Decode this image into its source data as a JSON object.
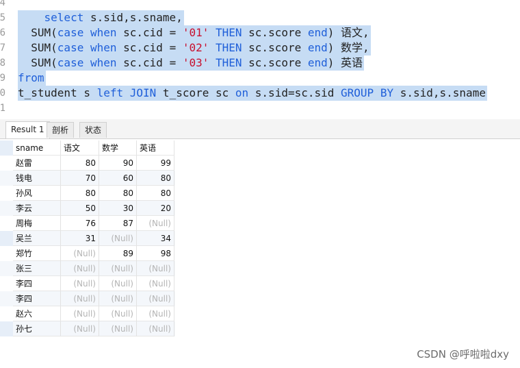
{
  "editor": {
    "lines": [
      {
        "num": "4",
        "tokens": []
      },
      {
        "num": "5",
        "tokens": [
          {
            "t": "    ",
            "c": ""
          },
          {
            "t": "select",
            "c": "kw"
          },
          {
            "t": " s.sid,s.sname,",
            "c": ""
          }
        ]
      },
      {
        "num": "6",
        "tokens": [
          {
            "t": "  SUM(",
            "c": ""
          },
          {
            "t": "case",
            "c": "kw"
          },
          {
            "t": " ",
            "c": ""
          },
          {
            "t": "when",
            "c": "kw"
          },
          {
            "t": " sc.cid = ",
            "c": ""
          },
          {
            "t": "'01'",
            "c": "str"
          },
          {
            "t": " ",
            "c": ""
          },
          {
            "t": "THEN",
            "c": "kw"
          },
          {
            "t": " sc.score ",
            "c": ""
          },
          {
            "t": "end",
            "c": "kw"
          },
          {
            "t": ") 语文,",
            "c": ""
          }
        ]
      },
      {
        "num": "7",
        "tokens": [
          {
            "t": "  SUM(",
            "c": ""
          },
          {
            "t": "case",
            "c": "kw"
          },
          {
            "t": " ",
            "c": ""
          },
          {
            "t": "when",
            "c": "kw"
          },
          {
            "t": " sc.cid = ",
            "c": ""
          },
          {
            "t": "'02'",
            "c": "str"
          },
          {
            "t": " ",
            "c": ""
          },
          {
            "t": "THEN",
            "c": "kw"
          },
          {
            "t": " sc.score ",
            "c": ""
          },
          {
            "t": "end",
            "c": "kw"
          },
          {
            "t": ") 数学,",
            "c": ""
          }
        ]
      },
      {
        "num": "8",
        "tokens": [
          {
            "t": "  SUM(",
            "c": ""
          },
          {
            "t": "case",
            "c": "kw"
          },
          {
            "t": " ",
            "c": ""
          },
          {
            "t": "when",
            "c": "kw"
          },
          {
            "t": " sc.cid = ",
            "c": ""
          },
          {
            "t": "'03'",
            "c": "str"
          },
          {
            "t": " ",
            "c": ""
          },
          {
            "t": "THEN",
            "c": "kw"
          },
          {
            "t": " sc.score ",
            "c": ""
          },
          {
            "t": "end",
            "c": "kw"
          },
          {
            "t": ") 英语",
            "c": ""
          }
        ]
      },
      {
        "num": "9",
        "tokens": [
          {
            "t": "from",
            "c": "kw"
          }
        ]
      },
      {
        "num": "0",
        "tokens": [
          {
            "t": "t_student s ",
            "c": ""
          },
          {
            "t": "left",
            "c": "kw"
          },
          {
            "t": " ",
            "c": ""
          },
          {
            "t": "JOIN",
            "c": "kw"
          },
          {
            "t": " t_score sc ",
            "c": ""
          },
          {
            "t": "on",
            "c": "kw"
          },
          {
            "t": " s.sid=sc.sid ",
            "c": ""
          },
          {
            "t": "GROUP",
            "c": "kw"
          },
          {
            "t": " ",
            "c": ""
          },
          {
            "t": "BY",
            "c": "kw"
          },
          {
            "t": " s.sid,s.sname",
            "c": ""
          }
        ]
      },
      {
        "num": "1",
        "tokens": []
      }
    ]
  },
  "tabs": [
    "Result 1",
    "剖析",
    "状态"
  ],
  "result": {
    "columns": [
      "sname",
      "语文",
      "数学",
      "英语"
    ],
    "rows": [
      [
        "赵雷",
        "80",
        "90",
        "99"
      ],
      [
        "钱电",
        "70",
        "60",
        "80"
      ],
      [
        "孙风",
        "80",
        "80",
        "80"
      ],
      [
        "李云",
        "50",
        "30",
        "20"
      ],
      [
        "周梅",
        "76",
        "87",
        "(Null)"
      ],
      [
        "吴兰",
        "31",
        "(Null)",
        "34"
      ],
      [
        "郑竹",
        "(Null)",
        "89",
        "98"
      ],
      [
        "张三",
        "(Null)",
        "(Null)",
        "(Null)"
      ],
      [
        "李四",
        "(Null)",
        "(Null)",
        "(Null)"
      ],
      [
        "李四",
        "(Null)",
        "(Null)",
        "(Null)"
      ],
      [
        "赵六",
        "(Null)",
        "(Null)",
        "(Null)"
      ],
      [
        "孙七",
        "(Null)",
        "(Null)",
        "(Null)"
      ]
    ],
    "null_label": "(Null)"
  },
  "watermark": "CSDN @呼啦啦dxy",
  "colors": {
    "selection": "#c6dcf4",
    "keyword": "#1f5fd9",
    "string": "#c8102e",
    "row_alt": "#f4f7fb",
    "row_indicator": "#e6eef8"
  }
}
